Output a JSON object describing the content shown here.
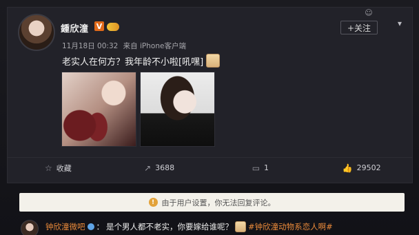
{
  "post": {
    "username": "鍾欣潼",
    "verified_badge": "V",
    "follow_label": "+关注",
    "timestamp": "11月18日 00:32",
    "source": "来自 iPhone客户端",
    "text": "老实人在何方？我年龄不小啦[吼嘿]",
    "icons": {
      "avatar": "user-avatar",
      "member": "vip-member-icon",
      "menu": "chevron-down-icon",
      "emoji": "emoji-icon"
    }
  },
  "actions": {
    "favorite": {
      "label": "收藏",
      "icon": "star-icon"
    },
    "repost": {
      "label": "3688",
      "icon": "share-icon"
    },
    "comment": {
      "label": "1",
      "icon": "comment-icon"
    },
    "like": {
      "label": "29502",
      "icon": "thumbs-up-icon"
    }
  },
  "notice": {
    "text": "由于用户设置，你无法回复评论。",
    "icon": "info-icon"
  },
  "comment": {
    "user": "钟欣潼微吧",
    "separator": "：",
    "text": "是个男人都不老实，你要嫁给谁呢？",
    "hashtag": "#钟欣潼动物系恋人啊#"
  },
  "colors": {
    "accent": "#e9893a",
    "background": "#222229",
    "notice_bg": "#f3f1ea"
  }
}
